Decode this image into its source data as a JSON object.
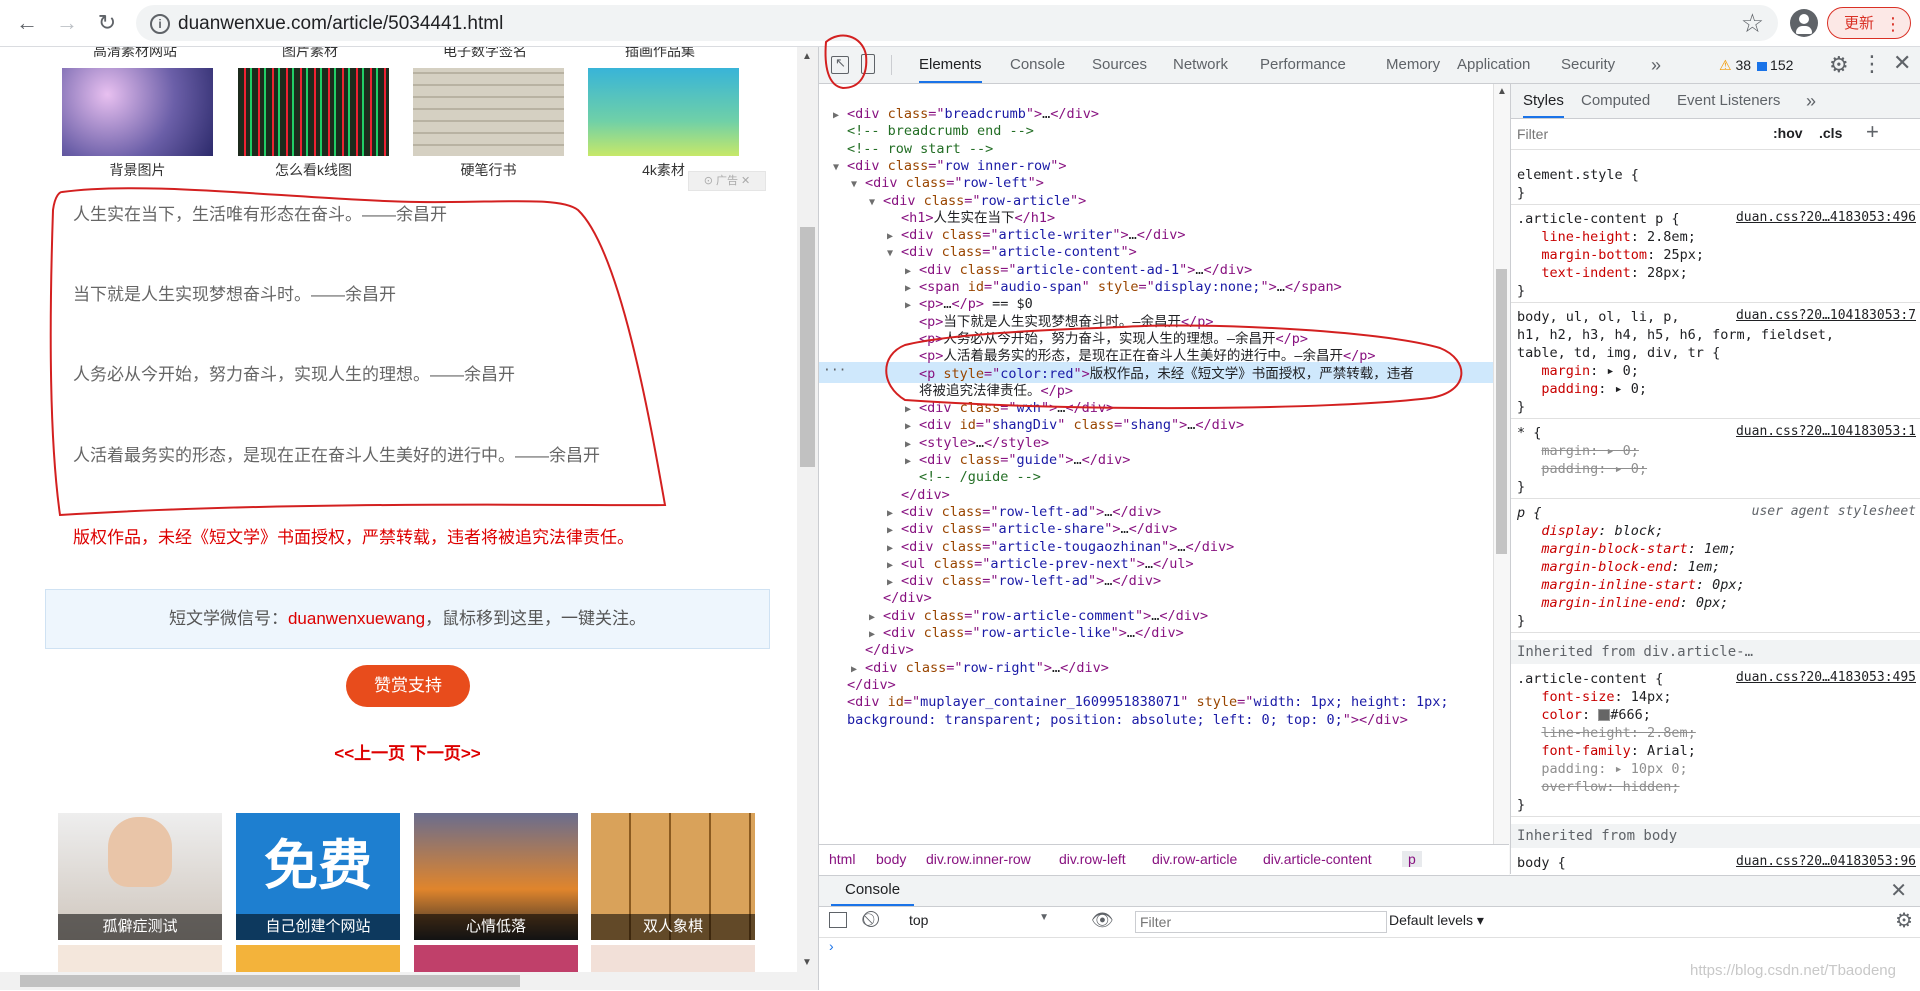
{
  "browser": {
    "url": "duanwenxue.com/article/5034441.html",
    "update_label": "更新",
    "icons": [
      "back-icon",
      "forward-icon",
      "reload-icon",
      "info-icon",
      "star-icon",
      "account-icon"
    ]
  },
  "page": {
    "top_captions": [
      "高清素材网站",
      "图片素材",
      "电子数字签名",
      "插画作品集"
    ],
    "thumbs": [
      {
        "caption": "背景图片",
        "color": "#6b5fa8"
      },
      {
        "caption": "怎么看k线图",
        "color": "#1c2a1c"
      },
      {
        "caption": "硬笔行书",
        "color": "#c9c4b6"
      },
      {
        "caption": "4k素材",
        "color": "#6fd0a8"
      }
    ],
    "ad_tag": "广告",
    "paragraphs": [
      "人生实在当下，生活唯有形态在奋斗。——余昌开",
      "当下就是人生实现梦想奋斗时。——余昌开",
      "人务必从今开始，努力奋斗，实现人生的理想。——余昌开",
      "人活着最务实的形态，是现在正在奋斗人生美好的进行中。——余昌开"
    ],
    "copyright": "版权作品，未经《短文学》书面授权，严禁转载，违者将被追究法律责任。",
    "wechat_prefix": "短文学微信号：",
    "wechat_id": "duanwenxuewang",
    "wechat_suffix": "，鼠标移到这里，一键关注。",
    "reward_label": "赞赏支持",
    "pager_label": "<<上一页  下一页>>",
    "related": [
      {
        "caption": "孤僻症测试",
        "color": "#d8d4cf"
      },
      {
        "caption": "自己创建个网站",
        "color": "#1e7fd0",
        "banner": "免费"
      },
      {
        "caption": "心情低落",
        "color": "#e0852c"
      },
      {
        "caption": "双人象棋",
        "color": "#d9a25a"
      }
    ]
  },
  "devtools": {
    "tabs": [
      "Elements",
      "Console",
      "Sources",
      "Network",
      "Performance",
      "Memory",
      "Application",
      "Security"
    ],
    "active_tab": "Elements",
    "more_tabs": "»",
    "warnings": "38",
    "messages": "152",
    "dom_lines": [
      {
        "i": 0,
        "tri": "▶",
        "h": "<span class='tg'>&lt;div </span><span class='at'>class</span><span class='tg'>=\"</span><span class='av'>breadcrumb</span><span class='tg'>\"&gt;</span><span class='tx'>…</span><span class='tg'>&lt;/div&gt;</span>"
      },
      {
        "i": 0,
        "tri": "",
        "h": "<span class='cm'>&lt;!-- breadcrumb end --&gt;</span>"
      },
      {
        "i": 0,
        "tri": "",
        "h": "<span class='cm'>&lt;!-- row start --&gt;</span>"
      },
      {
        "i": 0,
        "tri": "▼",
        "h": "<span class='tg'>&lt;div </span><span class='at'>class</span><span class='tg'>=\"</span><span class='av'>row inner-row</span><span class='tg'>\"&gt;</span>"
      },
      {
        "i": 1,
        "tri": "▼",
        "h": "<span class='tg'>&lt;div </span><span class='at'>class</span><span class='tg'>=\"</span><span class='av'>row-left</span><span class='tg'>\"&gt;</span>"
      },
      {
        "i": 2,
        "tri": "▼",
        "h": "<span class='tg'>&lt;div </span><span class='at'>class</span><span class='tg'>=\"</span><span class='av'>row-article</span><span class='tg'>\"&gt;</span>"
      },
      {
        "i": 3,
        "tri": "",
        "h": "<span class='tg'>&lt;h1&gt;</span><span class='tx'>人生实在当下</span><span class='tg'>&lt;/h1&gt;</span>"
      },
      {
        "i": 3,
        "tri": "▶",
        "h": "<span class='tg'>&lt;div </span><span class='at'>class</span><span class='tg'>=\"</span><span class='av'>article-writer</span><span class='tg'>\"&gt;</span><span class='tx'>…</span><span class='tg'>&lt;/div&gt;</span>"
      },
      {
        "i": 3,
        "tri": "▼",
        "h": "<span class='tg'>&lt;div </span><span class='at'>class</span><span class='tg'>=\"</span><span class='av'>article-content</span><span class='tg'>\"&gt;</span>"
      },
      {
        "i": 4,
        "tri": "▶",
        "h": "<span class='tg'>&lt;div </span><span class='at'>class</span><span class='tg'>=\"</span><span class='av'>article-content-ad-1</span><span class='tg'>\"&gt;</span><span class='tx'>…</span><span class='tg'>&lt;/div&gt;</span>"
      },
      {
        "i": 4,
        "tri": "▶",
        "h": "<span class='tg'>&lt;span </span><span class='at'>id</span><span class='tg'>=\"</span><span class='av'>audio-span</span><span class='tg'>\" </span><span class='at'>style</span><span class='tg'>=\"</span><span class='av'>display:none;</span><span class='tg'>\"&gt;</span><span class='tx'>…</span><span class='tg'>&lt;/span&gt;</span>"
      },
      {
        "i": 4,
        "tri": "▶",
        "h": "<span class='tg'>&lt;p&gt;</span><span class='tx'>…</span><span class='tg'>&lt;/p&gt;</span><span class='tx'> == $0</span>"
      },
      {
        "i": 4,
        "tri": "",
        "h": "<span class='tg'>&lt;p&gt;</span><span class='tx'>当下就是人生实现梦想奋斗时。—余昌开</span><span class='tg'>&lt;/p&gt;</span>"
      },
      {
        "i": 4,
        "tri": "",
        "h": "<span class='tg'>&lt;p&gt;</span><span class='tx'>人务必从今开始，努力奋斗，实现人生的理想。—余昌开</span><span class='tg'>&lt;/p&gt;</span>"
      },
      {
        "i": 4,
        "tri": "",
        "h": "<span class='tg'>&lt;p&gt;</span><span class='tx'>人活着最务实的形态，是现在正在奋斗人生美好的进行中。—余昌开</span><span class='tg'>&lt;/p&gt;</span>"
      },
      {
        "i": 4,
        "tri": "",
        "h": "<span class='tg'>&lt;p </span><span class='at'>style</span><span class='tg'>=\"</span><span class='av'>color:red</span><span class='tg'>\"&gt;</span><span class='tx'>版权作品，未经《短文学》书面授权，严禁转载，违者</span>"
      },
      {
        "i": 4,
        "tri": "",
        "h": "<span class='tx'>将被追究法律责任。</span><span class='tg'>&lt;/p&gt;</span>"
      },
      {
        "i": 4,
        "tri": "▶",
        "h": "<span class='tg'>&lt;div </span><span class='at'>class</span><span class='tg'>=\"</span><span class='av'>wxh</span><span class='tg'>\"&gt;</span><span class='tx'>…</span><span class='tg'>&lt;/div&gt;</span>"
      },
      {
        "i": 4,
        "tri": "▶",
        "h": "<span class='tg'>&lt;div </span><span class='at'>id</span><span class='tg'>=\"</span><span class='av'>shangDiv</span><span class='tg'>\" </span><span class='at'>class</span><span class='tg'>=\"</span><span class='av'>shang</span><span class='tg'>\"&gt;</span><span class='tx'>…</span><span class='tg'>&lt;/div&gt;</span>"
      },
      {
        "i": 4,
        "tri": "▶",
        "h": "<span class='tg'>&lt;style&gt;</span><span class='tx'>…</span><span class='tg'>&lt;/style&gt;</span>"
      },
      {
        "i": 4,
        "tri": "▶",
        "h": "<span class='tg'>&lt;div </span><span class='at'>class</span><span class='tg'>=\"</span><span class='av'>guide</span><span class='tg'>\"&gt;</span><span class='tx'>…</span><span class='tg'>&lt;/div&gt;</span>"
      },
      {
        "i": 4,
        "tri": "",
        "h": "<span class='cm'>&lt;!-- /guide --&gt;</span>"
      },
      {
        "i": 3,
        "tri": "",
        "h": "<span class='tg'>&lt;/div&gt;</span>"
      },
      {
        "i": 3,
        "tri": "▶",
        "h": "<span class='tg'>&lt;div </span><span class='at'>class</span><span class='tg'>=\"</span><span class='av'>row-left-ad</span><span class='tg'>\"&gt;</span><span class='tx'>…</span><span class='tg'>&lt;/div&gt;</span>"
      },
      {
        "i": 3,
        "tri": "▶",
        "h": "<span class='tg'>&lt;div </span><span class='at'>class</span><span class='tg'>=\"</span><span class='av'>article-share</span><span class='tg'>\"&gt;</span><span class='tx'>…</span><span class='tg'>&lt;/div&gt;</span>"
      },
      {
        "i": 3,
        "tri": "▶",
        "h": "<span class='tg'>&lt;div </span><span class='at'>class</span><span class='tg'>=\"</span><span class='av'>article-tougaozhinan</span><span class='tg'>\"&gt;</span><span class='tx'>…</span><span class='tg'>&lt;/div&gt;</span>"
      },
      {
        "i": 3,
        "tri": "▶",
        "h": "<span class='tg'>&lt;ul </span><span class='at'>class</span><span class='tg'>=\"</span><span class='av'>article-prev-next</span><span class='tg'>\"&gt;</span><span class='tx'>…</span><span class='tg'>&lt;/ul&gt;</span>"
      },
      {
        "i": 3,
        "tri": "▶",
        "h": "<span class='tg'>&lt;div </span><span class='at'>class</span><span class='tg'>=\"</span><span class='av'>row-left-ad</span><span class='tg'>\"&gt;</span><span class='tx'>…</span><span class='tg'>&lt;/div&gt;</span>"
      },
      {
        "i": 2,
        "tri": "",
        "h": "<span class='tg'>&lt;/div&gt;</span>"
      },
      {
        "i": 2,
        "tri": "▶",
        "h": "<span class='tg'>&lt;div </span><span class='at'>class</span><span class='tg'>=\"</span><span class='av'>row-article-comment</span><span class='tg'>\"&gt;</span><span class='tx'>…</span><span class='tg'>&lt;/div&gt;</span>"
      },
      {
        "i": 2,
        "tri": "▶",
        "h": "<span class='tg'>&lt;div </span><span class='at'>class</span><span class='tg'>=\"</span><span class='av'>row-article-like</span><span class='tg'>\"&gt;</span><span class='tx'>…</span><span class='tg'>&lt;/div&gt;</span>"
      },
      {
        "i": 1,
        "tri": "",
        "h": "<span class='tg'>&lt;/div&gt;</span>"
      },
      {
        "i": 1,
        "tri": "▶",
        "h": "<span class='tg'>&lt;div </span><span class='at'>class</span><span class='tg'>=\"</span><span class='av'>row-right</span><span class='tg'>\"&gt;</span><span class='tx'>…</span><span class='tg'>&lt;/div&gt;</span>"
      },
      {
        "i": 0,
        "tri": "",
        "h": "<span class='tg'>&lt;/div&gt;</span>"
      },
      {
        "i": 0,
        "tri": "",
        "h": "<span class='tg'>&lt;div </span><span class='at'>id</span><span class='tg'>=\"</span><span class='av'>muplayer_container_1609951838071</span><span class='tg'>\" </span><span class='at'>style</span><span class='tg'>=\"</span><span class='av'>width: 1px; height: 1px;</span>"
      },
      {
        "i": 0,
        "tri": "",
        "h": "<span class='av'>background: transparent; position: absolute; left: 0; top: 0;</span><span class='tg'>\"&gt;&lt;/div&gt;</span>"
      }
    ],
    "breadcrumbs": [
      "html",
      "body",
      "div.row.inner-row",
      "div.row-left",
      "div.row-article",
      "div.article-content",
      "p"
    ],
    "styles_tabs": [
      "Styles",
      "Computed",
      "Event Listeners",
      "»"
    ],
    "styles_filter_placeholder": "Filter",
    "hov_label": ":hov",
    "cls_label": ".cls",
    "styles_lines": [
      {
        "t": "element.style {",
        "src": ""
      },
      {
        "t": "}",
        "src": ""
      },
      {
        "t": ".article-content p {",
        "src": "duan.css?20…4183053:496"
      },
      {
        "t": "  <span class='pn'>line-height</span>: 2.8em;",
        "src": ""
      },
      {
        "t": "  <span class='pn'>margin-bottom</span>: 25px;",
        "src": ""
      },
      {
        "t": "  <span class='pn'>text-indent</span>: 28px;",
        "src": ""
      },
      {
        "t": "}",
        "src": ""
      },
      {
        "t": "body, ul, ol, li, p,",
        "src": "duan.css?20…104183053:7"
      },
      {
        "t": "h1, h2, h3, h4, h5, h6, form, fieldset,",
        "src": ""
      },
      {
        "t": "table, td, img, div, tr {",
        "src": ""
      },
      {
        "t": "  <span class='pn'>margin</span>: ▸ 0;",
        "src": ""
      },
      {
        "t": "  <span class='pn'>padding</span>: ▸ 0;",
        "src": ""
      },
      {
        "t": "}",
        "src": ""
      },
      {
        "t": "* {",
        "src": "duan.css?20…104183053:1"
      },
      {
        "t": "  <span class='strike'>margin: ▸ 0;</span>",
        "src": ""
      },
      {
        "t": "  <span class='strike'>padding: ▸ 0;</span>",
        "src": ""
      },
      {
        "t": "}",
        "src": ""
      },
      {
        "t": "<i>p {</i>",
        "src": "user agent stylesheet"
      },
      {
        "t": "  <i><span class='pn'>display</span>: block;</i>",
        "src": ""
      },
      {
        "t": "  <i><span class='pn'>margin-block-start</span>: 1em;</i>",
        "src": ""
      },
      {
        "t": "  <i><span class='pn'>margin-block-end</span>: 1em;</i>",
        "src": ""
      },
      {
        "t": "  <i><span class='pn'>margin-inline-start</span>: 0px;</i>",
        "src": ""
      },
      {
        "t": "  <i><span class='pn'>margin-inline-end</span>: 0px;</i>",
        "src": ""
      },
      {
        "t": "}",
        "src": ""
      }
    ],
    "inherited_1": "Inherited from div.article-…",
    "styles_lines_2": [
      {
        "t": ".article-content {",
        "src": "duan.css?20…4183053:495"
      },
      {
        "t": "  <span class='pn'>font-size</span>: 14px;",
        "src": ""
      },
      {
        "t": "  <span class='pn'>color</span>: <span style='display:inline-block;width:10px;height:10px;background:#666;border:1px solid #999;vertical-align:middle'></span>#666;",
        "src": ""
      },
      {
        "t": "  <span class='strike'>line-height: 2.8em;</span>",
        "src": ""
      },
      {
        "t": "  <span class='pn'>font-family</span>: Arial;",
        "src": ""
      },
      {
        "t": "  <span class='strike' style='text-decoration:none'>padding: ▸ 10px 0;</span>",
        "src": ""
      },
      {
        "t": "  <span class='strike'>overflow: hidden;</span>",
        "src": ""
      },
      {
        "t": "}",
        "src": ""
      }
    ],
    "inherited_2": "Inherited from body",
    "body_rule": {
      "t": "body {",
      "src": "duan.css?20…04183053:96"
    },
    "console": {
      "tab_label": "Console",
      "context": "top",
      "filter_placeholder": "Filter",
      "levels": "Default levels ▾",
      "prompt": "›"
    }
  },
  "watermark": "https://blog.csdn.net/Tbaodeng"
}
